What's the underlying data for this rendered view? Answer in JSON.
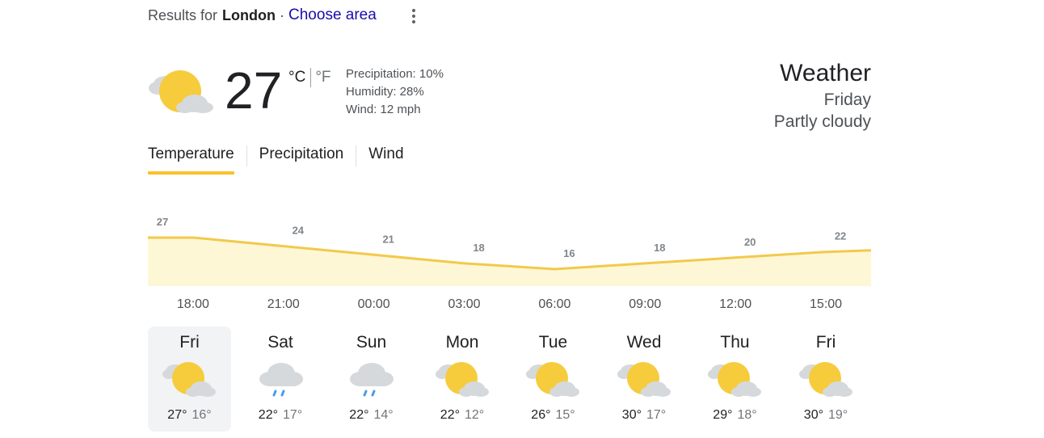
{
  "results": {
    "prefix": "Results for",
    "location": "London",
    "separator": "·",
    "choose_area": "Choose area"
  },
  "current": {
    "temperature": "27",
    "unit_c": "°C",
    "unit_f": "°F",
    "precipitation": "Precipitation: 10%",
    "humidity": "Humidity: 28%",
    "wind": "Wind: 12 mph",
    "icon": "partly-cloudy-icon"
  },
  "side": {
    "title": "Weather",
    "day": "Friday",
    "condition": "Partly cloudy"
  },
  "tabs": [
    {
      "label": "Temperature",
      "active": true
    },
    {
      "label": "Precipitation",
      "active": false
    },
    {
      "label": "Wind",
      "active": false
    }
  ],
  "colors": {
    "accent": "#fbc02d",
    "fill": "#fef7d6",
    "line": "#f2c94c",
    "link": "#1a0dab"
  },
  "chart_data": {
    "type": "area",
    "x": [
      "18:00",
      "21:00",
      "00:00",
      "03:00",
      "06:00",
      "09:00",
      "12:00",
      "15:00"
    ],
    "values": [
      27,
      24,
      21,
      18,
      16,
      18,
      20,
      22
    ],
    "title": "",
    "xlabel": "",
    "ylabel": ""
  },
  "forecast": [
    {
      "day": "Fri",
      "icon": "partly-cloudy-icon",
      "high": "27°",
      "low": "16°",
      "active": true
    },
    {
      "day": "Sat",
      "icon": "rain-icon",
      "high": "22°",
      "low": "17°"
    },
    {
      "day": "Sun",
      "icon": "rain-icon",
      "high": "22°",
      "low": "14°"
    },
    {
      "day": "Mon",
      "icon": "partly-cloudy-icon",
      "high": "22°",
      "low": "12°"
    },
    {
      "day": "Tue",
      "icon": "partly-cloudy-icon",
      "high": "26°",
      "low": "15°"
    },
    {
      "day": "Wed",
      "icon": "partly-cloudy-icon",
      "high": "30°",
      "low": "17°"
    },
    {
      "day": "Thu",
      "icon": "partly-cloudy-icon",
      "high": "29°",
      "low": "18°"
    },
    {
      "day": "Fri",
      "icon": "partly-cloudy-icon",
      "high": "30°",
      "low": "19°"
    }
  ]
}
